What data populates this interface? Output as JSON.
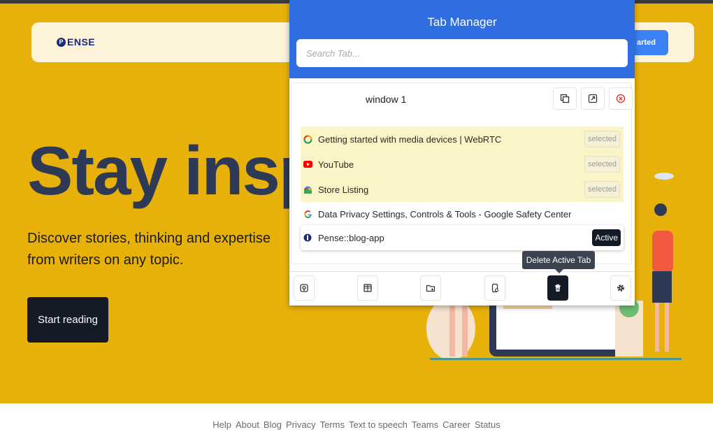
{
  "page": {
    "logo_mark": "P",
    "logo_text": "ENSE",
    "nav_cta": "arted",
    "hero_title": "Stay inspi",
    "hero_subtitle": "Discover stories, thinking and expertise from writers on any topic.",
    "start_button": "Start reading"
  },
  "footer": {
    "links": [
      "Help",
      "About",
      "Blog",
      "Privacy",
      "Terms",
      "Text to speech",
      "Teams",
      "Career",
      "Status"
    ]
  },
  "popup": {
    "title": "Tab Manager",
    "search_placeholder": "Search Tab...",
    "window": {
      "title": "window 1",
      "tabs": [
        {
          "label": "Getting started with media devices  |  WebRTC",
          "badge": "selected",
          "icon": "webrtc-icon"
        },
        {
          "label": "YouTube",
          "badge": "selected",
          "icon": "youtube-icon"
        },
        {
          "label": "Store Listing",
          "badge": "selected",
          "icon": "chrome-webstore-icon"
        },
        {
          "label": "Data Privacy Settings, Controls & Tools - Google Safety Center",
          "badge": "",
          "icon": "google-icon"
        },
        {
          "label": "Pense::blog-app",
          "badge": "Active",
          "icon": "pense-icon"
        }
      ]
    },
    "tooltip": "Delete Active Tab"
  },
  "colors": {
    "page_bg": "#e8b10a",
    "header_blue": "#2f6ee0",
    "selected_row": "#fbf4c6",
    "dark": "#151a27"
  }
}
